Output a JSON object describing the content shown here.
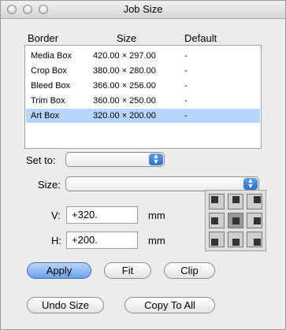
{
  "window": {
    "title": "Job Size"
  },
  "table": {
    "headers": [
      "Border",
      "Size",
      "Default"
    ],
    "rows": [
      {
        "border": "Media Box",
        "size": "420.00 × 297.00",
        "default": "-"
      },
      {
        "border": "Crop Box",
        "size": "380.00 × 280.00",
        "default": "-"
      },
      {
        "border": "Bleed Box",
        "size": "366.00 × 256.00",
        "default": "-"
      },
      {
        "border": "Trim Box",
        "size": "360.00 × 250.00",
        "default": "-"
      },
      {
        "border": "Art Box",
        "size": "320.00 × 200.00",
        "default": "-"
      }
    ],
    "selected_row": 4
  },
  "form": {
    "set_to_label": "Set to:",
    "set_to_value": "",
    "size_label": "Size:",
    "size_value": "",
    "v_label": "V:",
    "v_value": "+320.",
    "v_unit": "mm",
    "h_label": "H:",
    "h_value": "+200.",
    "h_unit": "mm"
  },
  "anchor": {
    "selected_cell": 4
  },
  "buttons": {
    "apply": "Apply",
    "fit": "Fit",
    "clip": "Clip",
    "undo_size": "Undo Size",
    "copy_to_all": "Copy To All"
  },
  "icons": {
    "close": "close-icon",
    "minimize": "minimize-icon",
    "zoom": "zoom-icon",
    "popup": "updown-arrow-icon"
  }
}
